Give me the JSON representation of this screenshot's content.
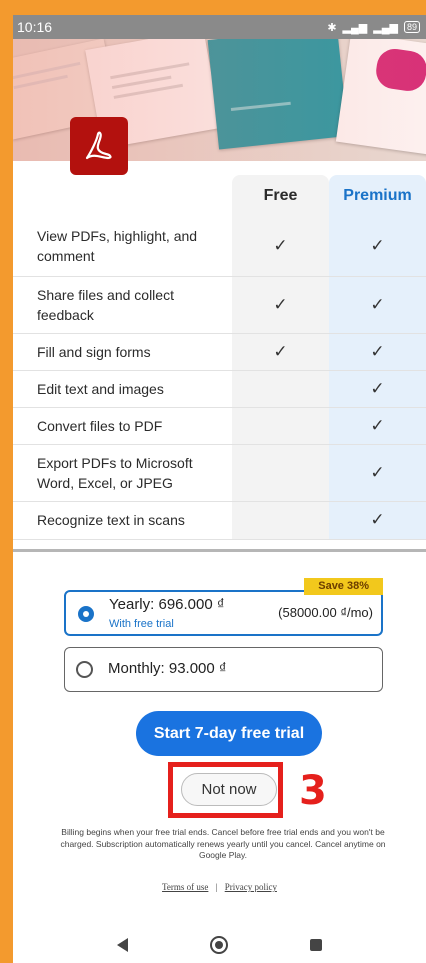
{
  "status_bar": {
    "time": "10:16",
    "battery": "89"
  },
  "comparison": {
    "free_header": "Free",
    "premium_header": "Premium",
    "features": [
      {
        "label": "View PDFs, highlight, and comment",
        "free": "✓",
        "premium": "✓"
      },
      {
        "label": "Share files and collect feedback",
        "free": "✓",
        "premium": "✓"
      },
      {
        "label": "Fill and sign forms",
        "free": "✓",
        "premium": "✓"
      },
      {
        "label": "Edit text and images",
        "free": "",
        "premium": "✓"
      },
      {
        "label": "Convert files to PDF",
        "free": "",
        "premium": "✓"
      },
      {
        "label": "Export PDFs to Microsoft Word, Excel, or JPEG",
        "free": "",
        "premium": "✓"
      },
      {
        "label": "Recognize text in scans",
        "free": "",
        "premium": "✓"
      }
    ]
  },
  "plans": {
    "yearly": {
      "title": "Yearly: 696.000 ₫",
      "subtitle": "With free trial",
      "per_month": "(58000.00 ₫/mo)",
      "badge": "Save 38%",
      "selected": true
    },
    "monthly": {
      "title": "Monthly: 93.000 ₫",
      "selected": false
    }
  },
  "cta_label": "Start 7-day free trial",
  "not_now_label": "Not now",
  "annotation_step": "3",
  "billing_text": "Billing begins when your free trial ends. Cancel before free trial ends and you won't be charged. Subscription automatically renews yearly until you cancel. Cancel anytime on Google Play.",
  "links": {
    "terms": "Terms of use",
    "separator": "|",
    "privacy": "Privacy policy"
  },
  "colors": {
    "page_bg": "#F39A2E",
    "accent_blue": "#1a73e0",
    "adobe_red": "#B3110E",
    "highlight_red": "#E5201C",
    "badge_yellow": "#F2C81C"
  }
}
